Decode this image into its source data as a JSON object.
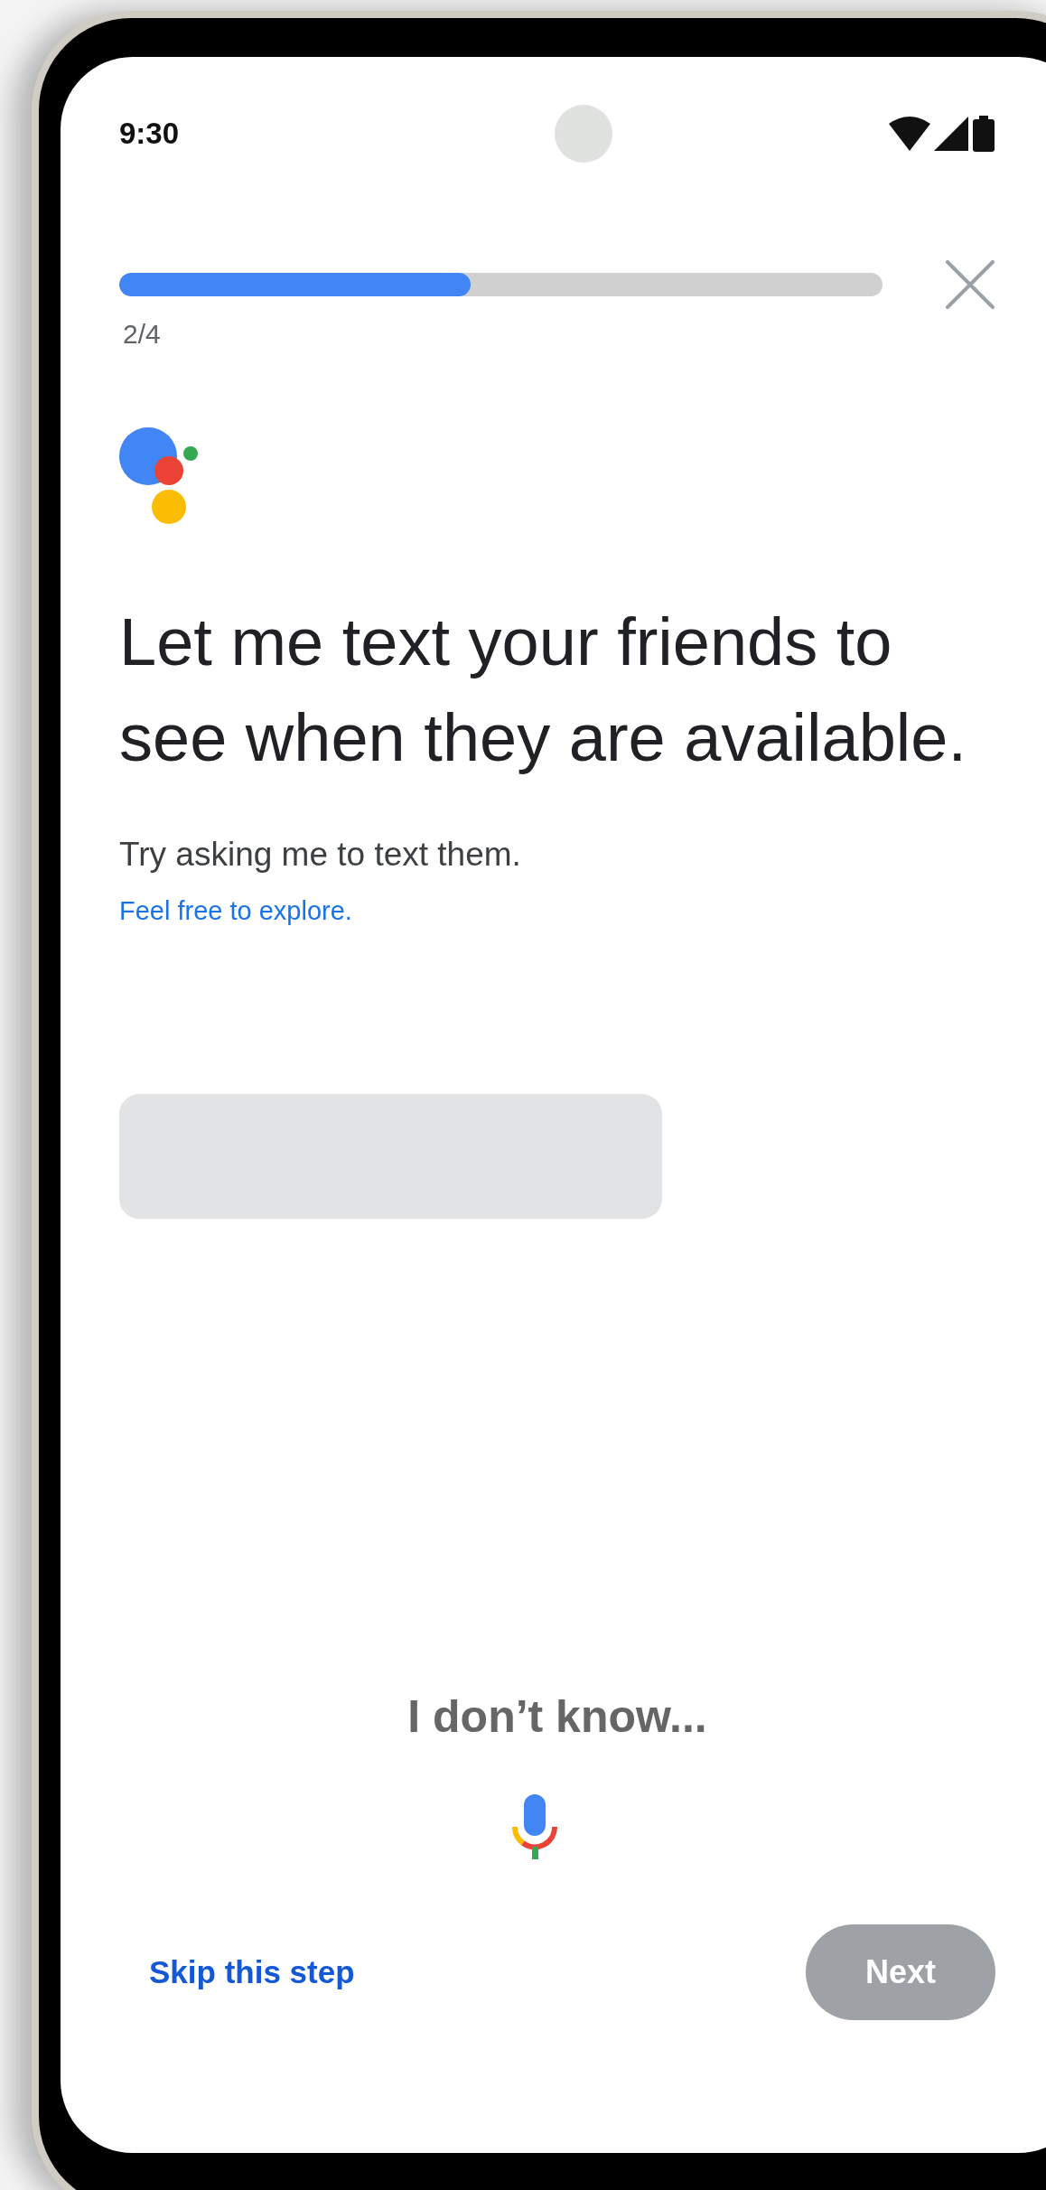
{
  "status_bar": {
    "time": "9:30"
  },
  "progress": {
    "level": 0.46,
    "label": "2/4"
  },
  "heading": "Let me text your friends to see when they are available.",
  "subtitle": "Try asking me to text them.",
  "link": "Feel free to explore.",
  "utterance": "I don’t know...",
  "footer": {
    "skip": "Skip this step",
    "next": {
      "label": "Next",
      "disabled": true
    }
  }
}
